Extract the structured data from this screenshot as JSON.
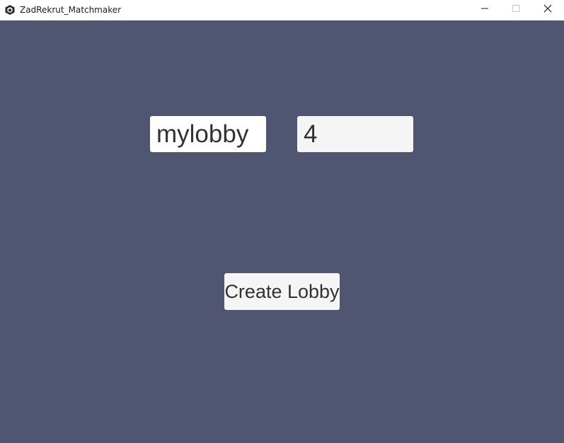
{
  "window": {
    "title": "ZadRekrut_Matchmaker",
    "app_icon": "unity-logo-icon",
    "controls": [
      "minimize-icon",
      "maximize-icon",
      "close-icon"
    ]
  },
  "form": {
    "lobby_name_value": "mylobby",
    "max_players_value": "4",
    "create_button_label": "Create Lobby"
  },
  "colors": {
    "background": "#505671",
    "field_bg": "#ffffff",
    "field_bg_alt": "#f5f5f5",
    "text": "#323232"
  }
}
